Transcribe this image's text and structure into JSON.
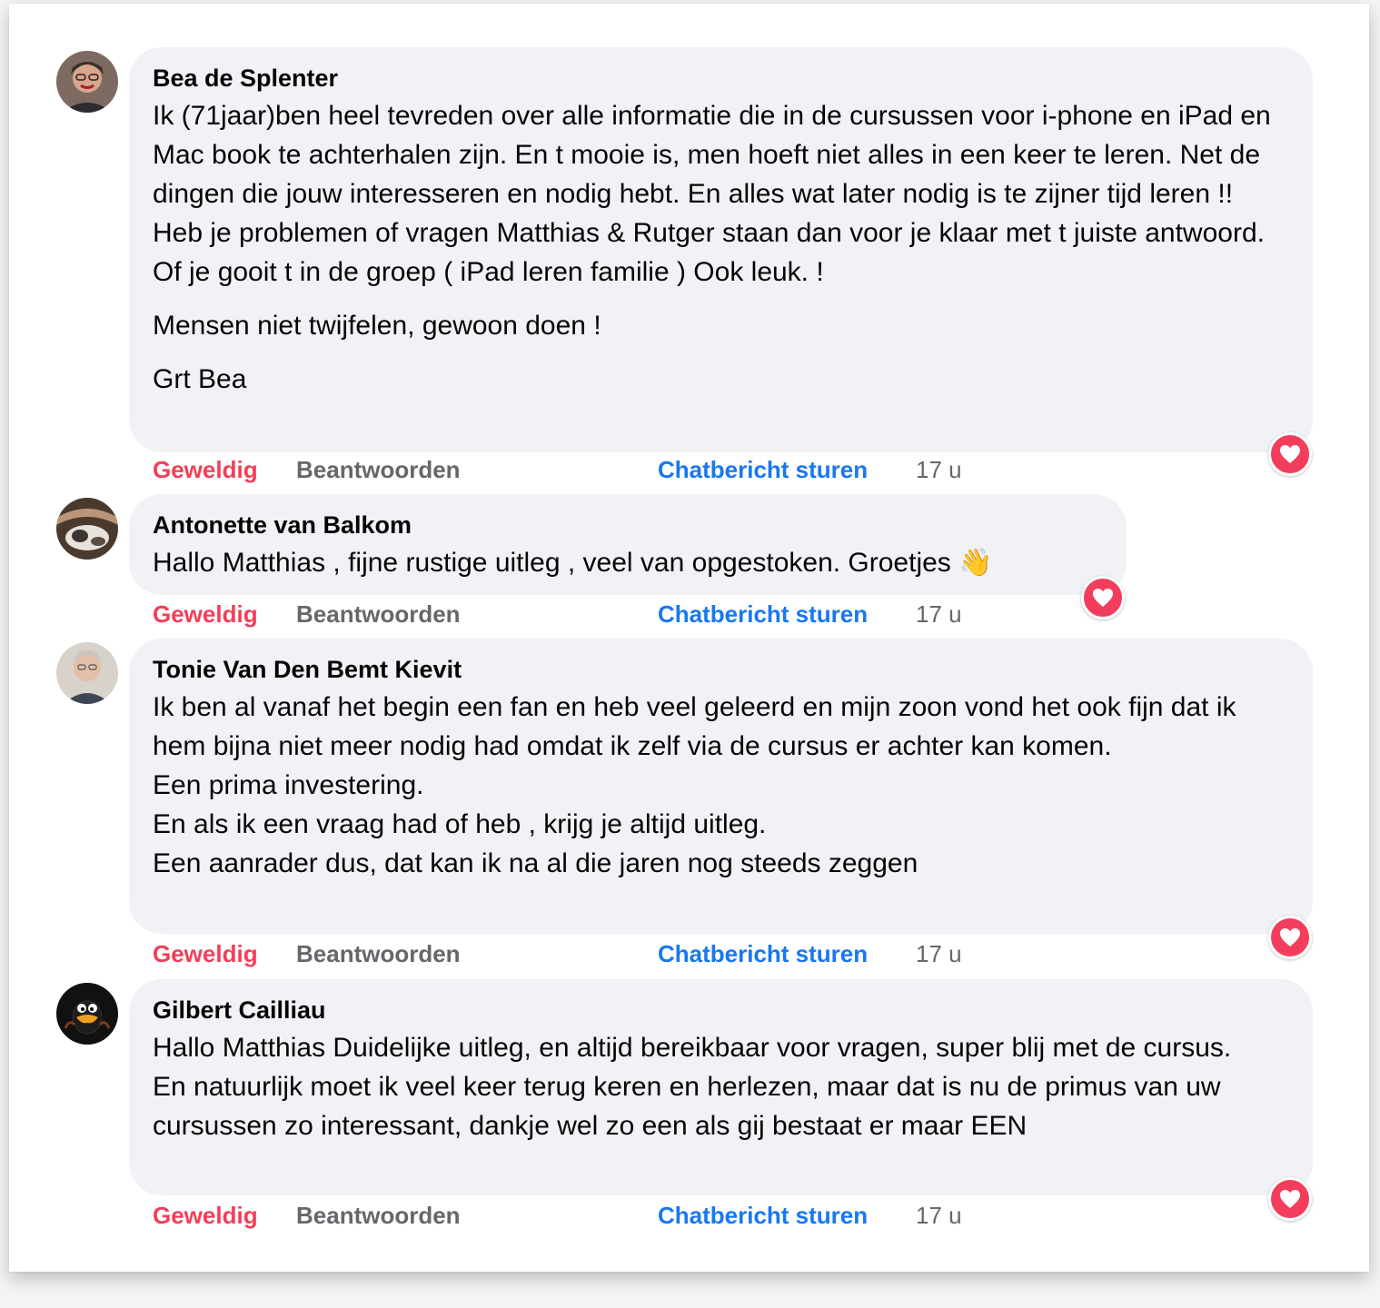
{
  "colors": {
    "reaction": "#f33e58",
    "link": "#1877f2",
    "muted": "#65676b",
    "bubble": "#f0f2f5"
  },
  "comments": [
    {
      "author": "Bea de Splenter",
      "paragraphs": [
        "Ik (71jaar)ben heel tevreden over alle informatie die in de cursussen voor i-phone en iPad en Mac book te achterhalen zijn. En t mooie is, men hoeft niet alles in een keer te leren. Net de dingen die jouw interesseren en nodig hebt. En alles wat later nodig is te zijner tijd leren !!\nHeb je problemen of vragen Matthias & Rutger staan dan voor je klaar met t juiste antwoord. Of je gooit t in de groep ( iPad leren familie ) Ook leuk. !",
        "Mensen niet twijfelen, gewoon doen !",
        "Grt Bea"
      ],
      "reaction_label": "Geweldig",
      "reply_label": "Beantwoorden",
      "chat_label": "Chatbericht sturen",
      "time": "17 u",
      "reaction_icon": "heart-icon"
    },
    {
      "author": "Antonette van Balkom",
      "paragraphs": [
        "Hallo Matthias , fijne rustige uitleg , veel van opgestoken. Groetjes 👋"
      ],
      "reaction_label": "Geweldig",
      "reply_label": "Beantwoorden",
      "chat_label": "Chatbericht sturen",
      "time": "17 u",
      "reaction_icon": "heart-icon"
    },
    {
      "author": "Tonie Van Den Bemt Kievit",
      "paragraphs": [
        "Ik ben al vanaf het begin een fan en heb veel geleerd en mijn zoon vond het ook fijn dat ik hem bijna niet meer nodig had omdat ik zelf via de cursus er achter kan komen.\nEen prima investering.\nEn als ik een vraag had of heb , krijg je altijd uitleg.\nEen aanrader dus, dat kan ik na al die jaren nog steeds zeggen"
      ],
      "reaction_label": "Geweldig",
      "reply_label": "Beantwoorden",
      "chat_label": "Chatbericht sturen",
      "time": "17 u",
      "reaction_icon": "heart-icon"
    },
    {
      "author": "Gilbert Cailliau",
      "paragraphs": [
        "Hallo Matthias Duidelijke uitleg, en altijd bereikbaar voor vragen, super blij met de cursus.\nEn natuurlijk moet ik veel keer terug keren en herlezen, maar dat is nu de primus van uw cursussen zo interessant, dankje wel zo een als gij bestaat er maar EEN"
      ],
      "reaction_label": "Geweldig",
      "reply_label": "Beantwoorden",
      "chat_label": "Chatbericht sturen",
      "time": "17 u",
      "reaction_icon": "heart-icon"
    }
  ]
}
